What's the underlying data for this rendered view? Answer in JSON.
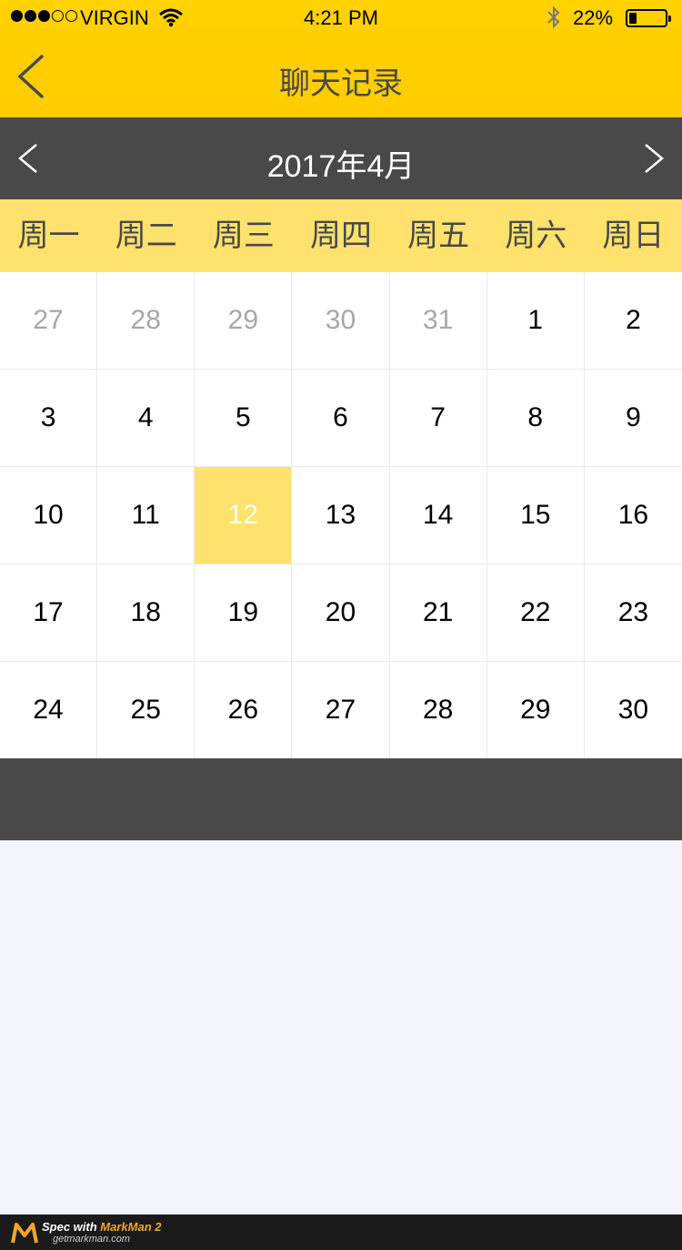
{
  "status_bar": {
    "carrier": "VIRGIN",
    "time": "4:21 PM",
    "battery": "22%",
    "battery_level": 0.22,
    "signal_dots_filled": 3,
    "signal_dots_total": 5
  },
  "nav": {
    "title": "聊天记录",
    "back_icon": "chevron-left-icon"
  },
  "calendar": {
    "month_title": "2017年4月",
    "prev_icon": "chevron-left-icon",
    "next_icon": "chevron-right-icon",
    "weekdays": [
      "周一",
      "周二",
      "周三",
      "周四",
      "周五",
      "周六",
      "周日"
    ],
    "selected_day": "12",
    "weeks": [
      [
        {
          "day": "27",
          "other": true
        },
        {
          "day": "28",
          "other": true
        },
        {
          "day": "29",
          "other": true
        },
        {
          "day": "30",
          "other": true
        },
        {
          "day": "31",
          "other": true
        },
        {
          "day": "1"
        },
        {
          "day": "2"
        }
      ],
      [
        {
          "day": "3"
        },
        {
          "day": "4"
        },
        {
          "day": "5"
        },
        {
          "day": "6"
        },
        {
          "day": "7"
        },
        {
          "day": "8"
        },
        {
          "day": "9"
        }
      ],
      [
        {
          "day": "10"
        },
        {
          "day": "11"
        },
        {
          "day": "12",
          "selected": true
        },
        {
          "day": "13"
        },
        {
          "day": "14"
        },
        {
          "day": "15"
        },
        {
          "day": "16"
        }
      ],
      [
        {
          "day": "17"
        },
        {
          "day": "18"
        },
        {
          "day": "19"
        },
        {
          "day": "20"
        },
        {
          "day": "21"
        },
        {
          "day": "22"
        },
        {
          "day": "23"
        }
      ],
      [
        {
          "day": "24"
        },
        {
          "day": "25"
        },
        {
          "day": "26"
        },
        {
          "day": "27"
        },
        {
          "day": "28"
        },
        {
          "day": "29"
        },
        {
          "day": "30"
        }
      ]
    ]
  },
  "colors": {
    "nav_background": "#ffd200",
    "dark_bar": "#494949",
    "weekday_background": "#ffe26d",
    "selected_background": "#ffe26d",
    "selected_text": "#ffffff",
    "other_month_text": "#a7a7a7",
    "grid_line": "#eaeaea",
    "page_background": "#f2f6fa"
  },
  "footer": {
    "line1_prefix": "Spec with ",
    "line1_accent": "MarkMan 2",
    "line2": "getmarkman.com"
  }
}
